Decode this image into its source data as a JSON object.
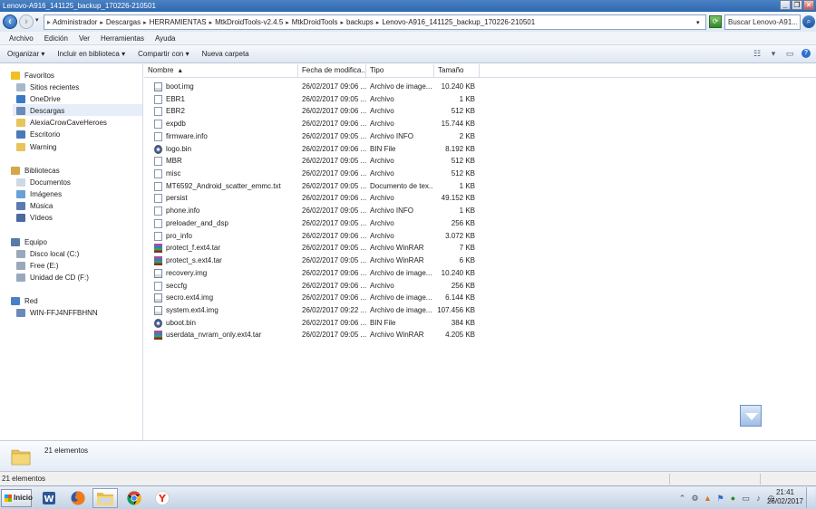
{
  "window": {
    "title": "Lenovo-A916_141125_backup_170226-210501",
    "buttons": {
      "minimize": "_",
      "maximize": "❐",
      "close": "×"
    }
  },
  "address": {
    "breadcrumb": [
      "Administrador",
      "Descargas",
      "HERRAMIENTAS",
      "MtkDroidTools-v2.4.5",
      "MtkDroidTools",
      "backups",
      "Lenovo-A916_141125_backup_170226-210501"
    ],
    "search_placeholder": "Buscar Lenovo-A91..."
  },
  "menu": [
    "Archivo",
    "Edición",
    "Ver",
    "Herramientas",
    "Ayuda"
  ],
  "toolbar": {
    "organize": "Organizar ▾",
    "include": "Incluir en biblioteca ▾",
    "share": "Compartir con ▾",
    "new_folder": "Nueva carpeta"
  },
  "nav": {
    "favorites_title": "Favoritos",
    "favorites": [
      "Sitios recientes",
      "OneDrive",
      "Descargas",
      "AlexiaCrowCaveHeroes",
      "Escritorio",
      "Warning"
    ],
    "libraries_title": "Bibliotecas",
    "libraries": [
      "Documentos",
      "Imágenes",
      "Música",
      "Vídeos"
    ],
    "computer_title": "Equipo",
    "computer": [
      "Disco local (C:)",
      "Free (E:)",
      "Unidad de CD (F:)"
    ],
    "network_title": "Red",
    "network": [
      "WIN-FFJ4NFFBHNN"
    ]
  },
  "columns": {
    "name": "Nombre",
    "name_sort": "▴",
    "date": "Fecha de modifica...",
    "type": "Tipo",
    "size": "Tamaño"
  },
  "files": [
    {
      "name": "boot.img",
      "date": "26/02/2017 09:06 ...",
      "type": "Archivo de image...",
      "size": "10.240 KB",
      "icon": "img"
    },
    {
      "name": "EBR1",
      "date": "26/02/2017 09:05 ...",
      "type": "Archivo",
      "size": "1 KB",
      "icon": "file"
    },
    {
      "name": "EBR2",
      "date": "26/02/2017 09:06 ...",
      "type": "Archivo",
      "size": "512 KB",
      "icon": "file"
    },
    {
      "name": "expdb",
      "date": "26/02/2017 09:06 ...",
      "type": "Archivo",
      "size": "15.744 KB",
      "icon": "file"
    },
    {
      "name": "firmware.info",
      "date": "26/02/2017 09:05 ...",
      "type": "Archivo INFO",
      "size": "2 KB",
      "icon": "file"
    },
    {
      "name": "logo.bin",
      "date": "26/02/2017 09:06 ...",
      "type": "BIN File",
      "size": "8.192 KB",
      "icon": "bin"
    },
    {
      "name": "MBR",
      "date": "26/02/2017 09:05 ...",
      "type": "Archivo",
      "size": "512 KB",
      "icon": "file"
    },
    {
      "name": "misc",
      "date": "26/02/2017 09:06 ...",
      "type": "Archivo",
      "size": "512 KB",
      "icon": "file"
    },
    {
      "name": "MT6592_Android_scatter_emmc.txt",
      "date": "26/02/2017 09:05 ...",
      "type": "Documento de tex...",
      "size": "1 KB",
      "icon": "file"
    },
    {
      "name": "persist",
      "date": "26/02/2017 09:06 ...",
      "type": "Archivo",
      "size": "49.152 KB",
      "icon": "file"
    },
    {
      "name": "phone.info",
      "date": "26/02/2017 09:05 ...",
      "type": "Archivo INFO",
      "size": "1 KB",
      "icon": "file"
    },
    {
      "name": "preloader_and_dsp",
      "date": "26/02/2017 09:05 ...",
      "type": "Archivo",
      "size": "256 KB",
      "icon": "file"
    },
    {
      "name": "pro_info",
      "date": "26/02/2017 09:06 ...",
      "type": "Archivo",
      "size": "3.072 KB",
      "icon": "file"
    },
    {
      "name": "protect_f.ext4.tar",
      "date": "26/02/2017 09:05 ...",
      "type": "Archivo WinRAR",
      "size": "7 KB",
      "icon": "rar"
    },
    {
      "name": "protect_s.ext4.tar",
      "date": "26/02/2017 09:05 ...",
      "type": "Archivo WinRAR",
      "size": "6 KB",
      "icon": "rar"
    },
    {
      "name": "recovery.img",
      "date": "26/02/2017 09:06 ...",
      "type": "Archivo de image...",
      "size": "10.240 KB",
      "icon": "img"
    },
    {
      "name": "seccfg",
      "date": "26/02/2017 09:06 ...",
      "type": "Archivo",
      "size": "256 KB",
      "icon": "file"
    },
    {
      "name": "secro.ext4.img",
      "date": "26/02/2017 09:06 ...",
      "type": "Archivo de image...",
      "size": "6.144 KB",
      "icon": "img"
    },
    {
      "name": "system.ext4.img",
      "date": "26/02/2017 09:22 ...",
      "type": "Archivo de image...",
      "size": "107.456 KB",
      "icon": "img"
    },
    {
      "name": "uboot.bin",
      "date": "26/02/2017 09:06 ...",
      "type": "BIN File",
      "size": "384 KB",
      "icon": "bin"
    },
    {
      "name": "userdata_nvram_only.ext4.tar",
      "date": "26/02/2017 09:05 ...",
      "type": "Archivo WinRAR",
      "size": "4.205 KB",
      "icon": "rar"
    }
  ],
  "details_count": "21 elementos",
  "status_count": "21 elementos",
  "clock": {
    "time": "21:41",
    "date": "26/02/2017"
  },
  "start_label": "Inicio"
}
